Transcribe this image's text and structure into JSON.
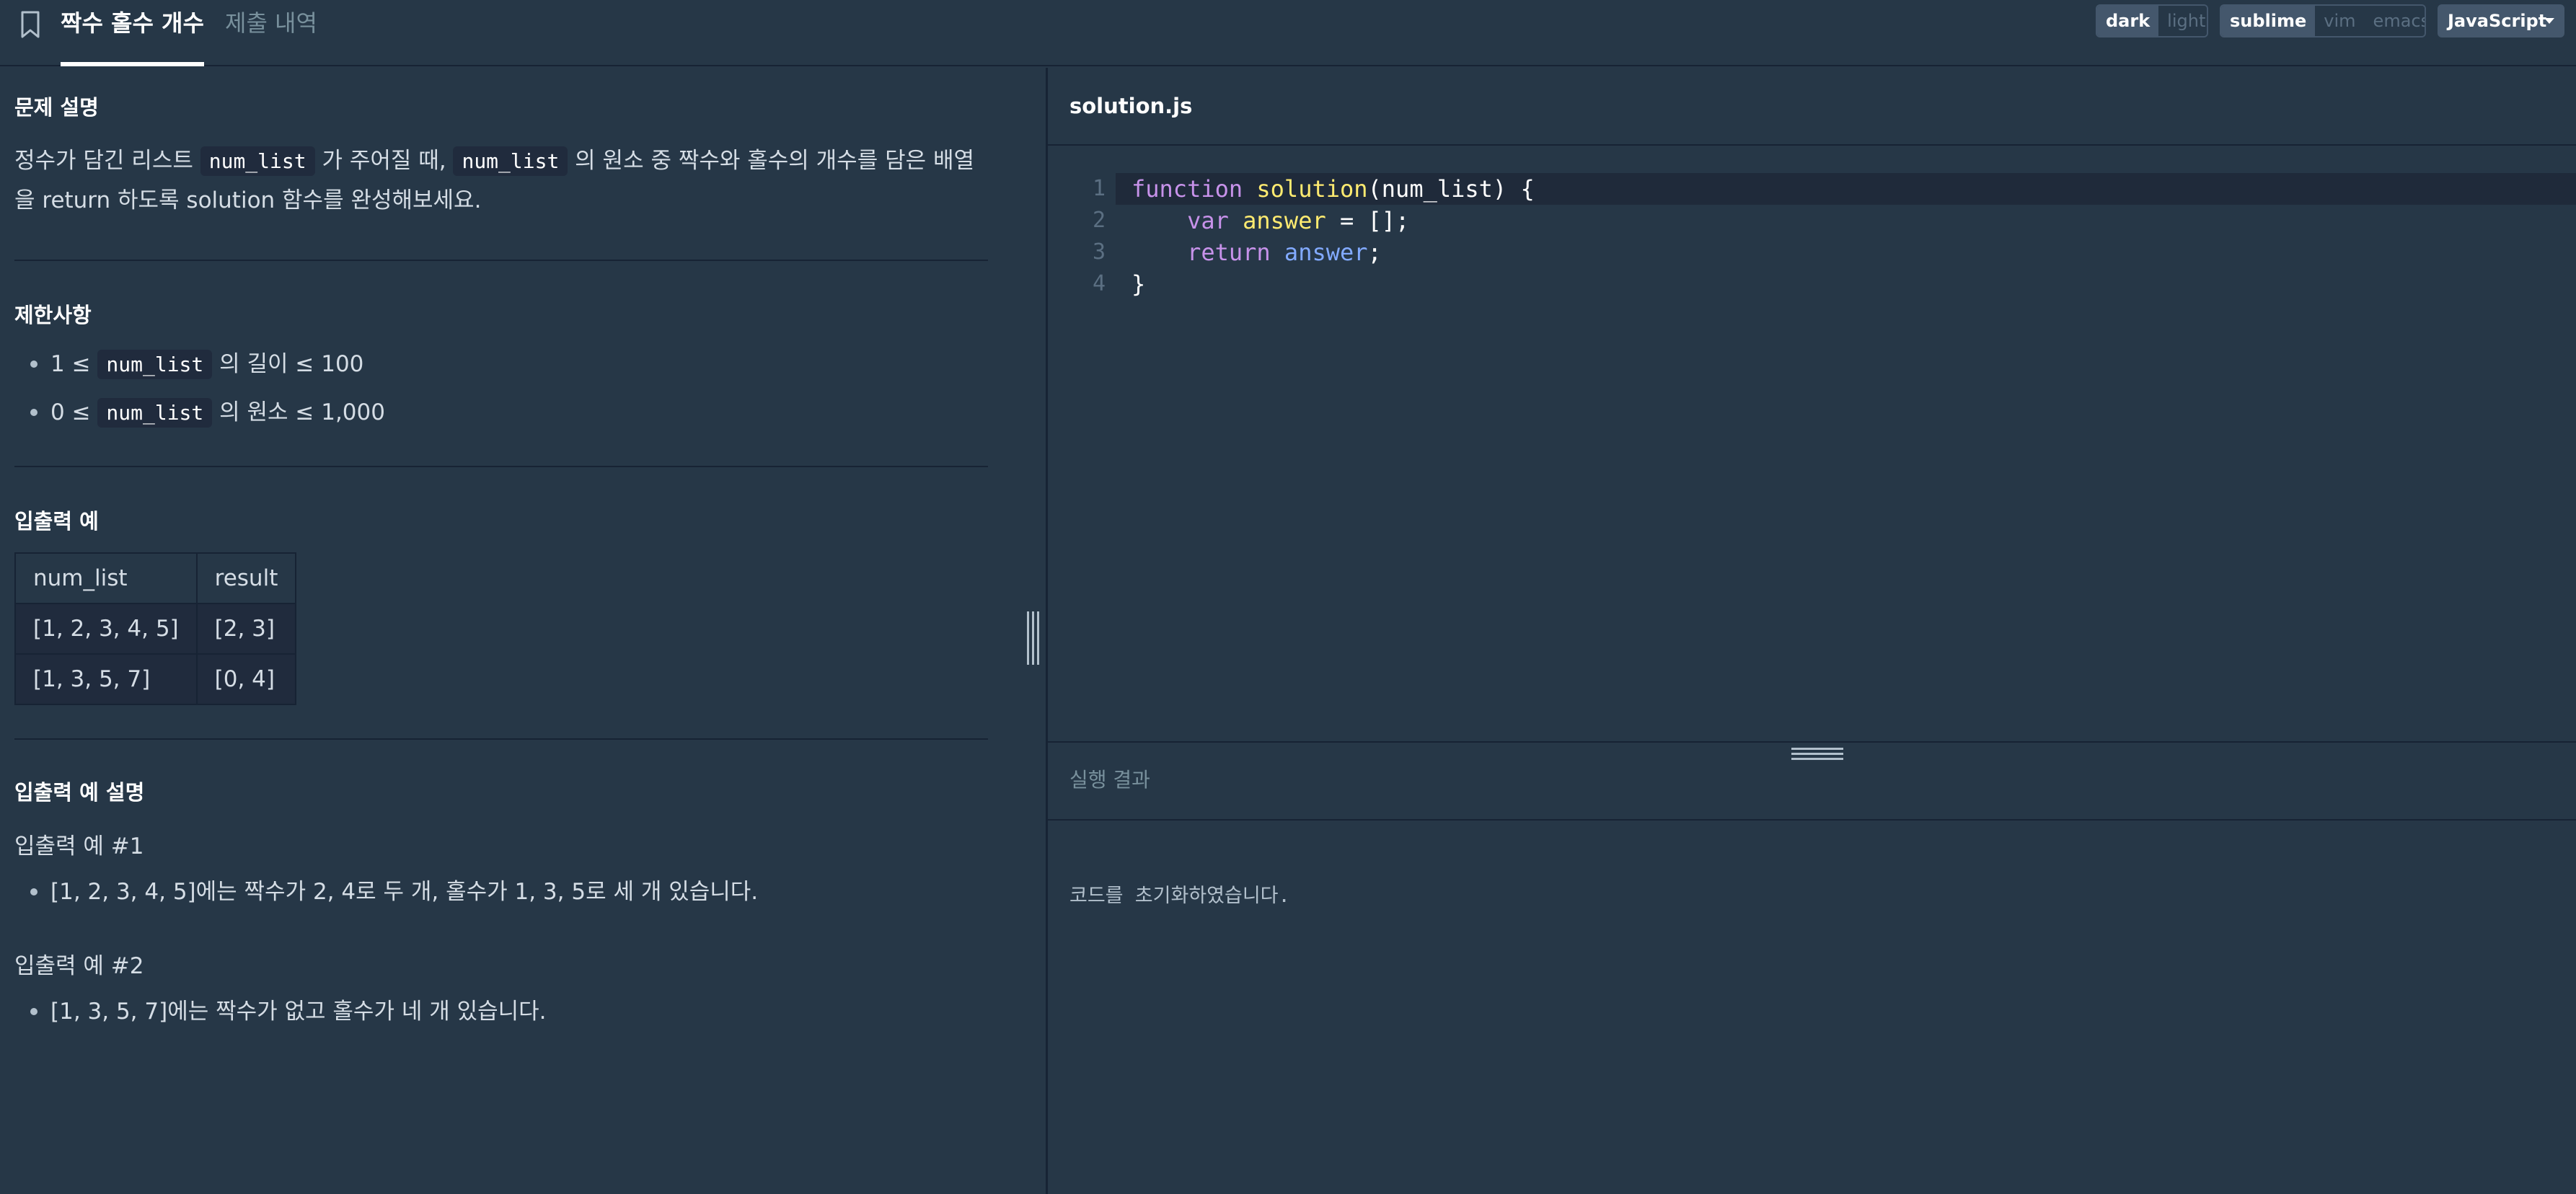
{
  "header": {
    "problem_tab": "짝수 홀수 개수",
    "submissions_tab": "제출 내역",
    "theme": {
      "dark": "dark",
      "light": "light",
      "selected": "dark"
    },
    "keymap": {
      "sublime": "sublime",
      "vim": "vim",
      "emacs": "emacs",
      "selected": "sublime"
    },
    "language": "JavaScript"
  },
  "description": {
    "title": "문제 설명",
    "text_1": "정수가 담긴 리스트 ",
    "code_1": "num_list",
    "text_2": " 가 주어질 때, ",
    "code_2": "num_list",
    "text_3": " 의 원소 중 짝수와 홀수의 개수를 담은 배열을 return 하도록 solution 함수를 완성해보세요."
  },
  "constraints": {
    "title": "제한사항",
    "items": [
      {
        "pre": "1 ≤ ",
        "code": "num_list",
        "post": " 의 길이 ≤ 100"
      },
      {
        "pre": "0 ≤ ",
        "code": "num_list",
        "post": " 의 원소 ≤ 1,000"
      }
    ]
  },
  "examples": {
    "title": "입출력 예",
    "headers": [
      "num_list",
      "result"
    ],
    "rows": [
      [
        "[1, 2, 3, 4, 5]",
        "[2, 3]"
      ],
      [
        "[1, 3, 5, 7]",
        "[0, 4]"
      ]
    ]
  },
  "explanation": {
    "title": "입출력 예 설명",
    "ex1_title": "입출력 예 #1",
    "ex1_item": "[1, 2, 3, 4, 5]에는 짝수가 2, 4로 두 개, 홀수가 1, 3, 5로 세 개 있습니다.",
    "ex2_title": "입출력 예 #2",
    "ex2_item": "[1, 3, 5, 7]에는 짝수가 없고 홀수가 네 개 있습니다."
  },
  "editor": {
    "filename": "solution.js",
    "line_numbers": [
      "1",
      "2",
      "3",
      "4"
    ],
    "tokens": {
      "function_kw": "function",
      "fn_name": "solution",
      "params": "(num_list) {",
      "var_kw": "var",
      "var_name": "answer",
      "assign": " = [];",
      "return_kw": "return",
      "return_val": "answer",
      "semi": ";",
      "close": "}"
    }
  },
  "result": {
    "title": "실행 결과",
    "message": "코드를 초기화하였습니다."
  }
}
